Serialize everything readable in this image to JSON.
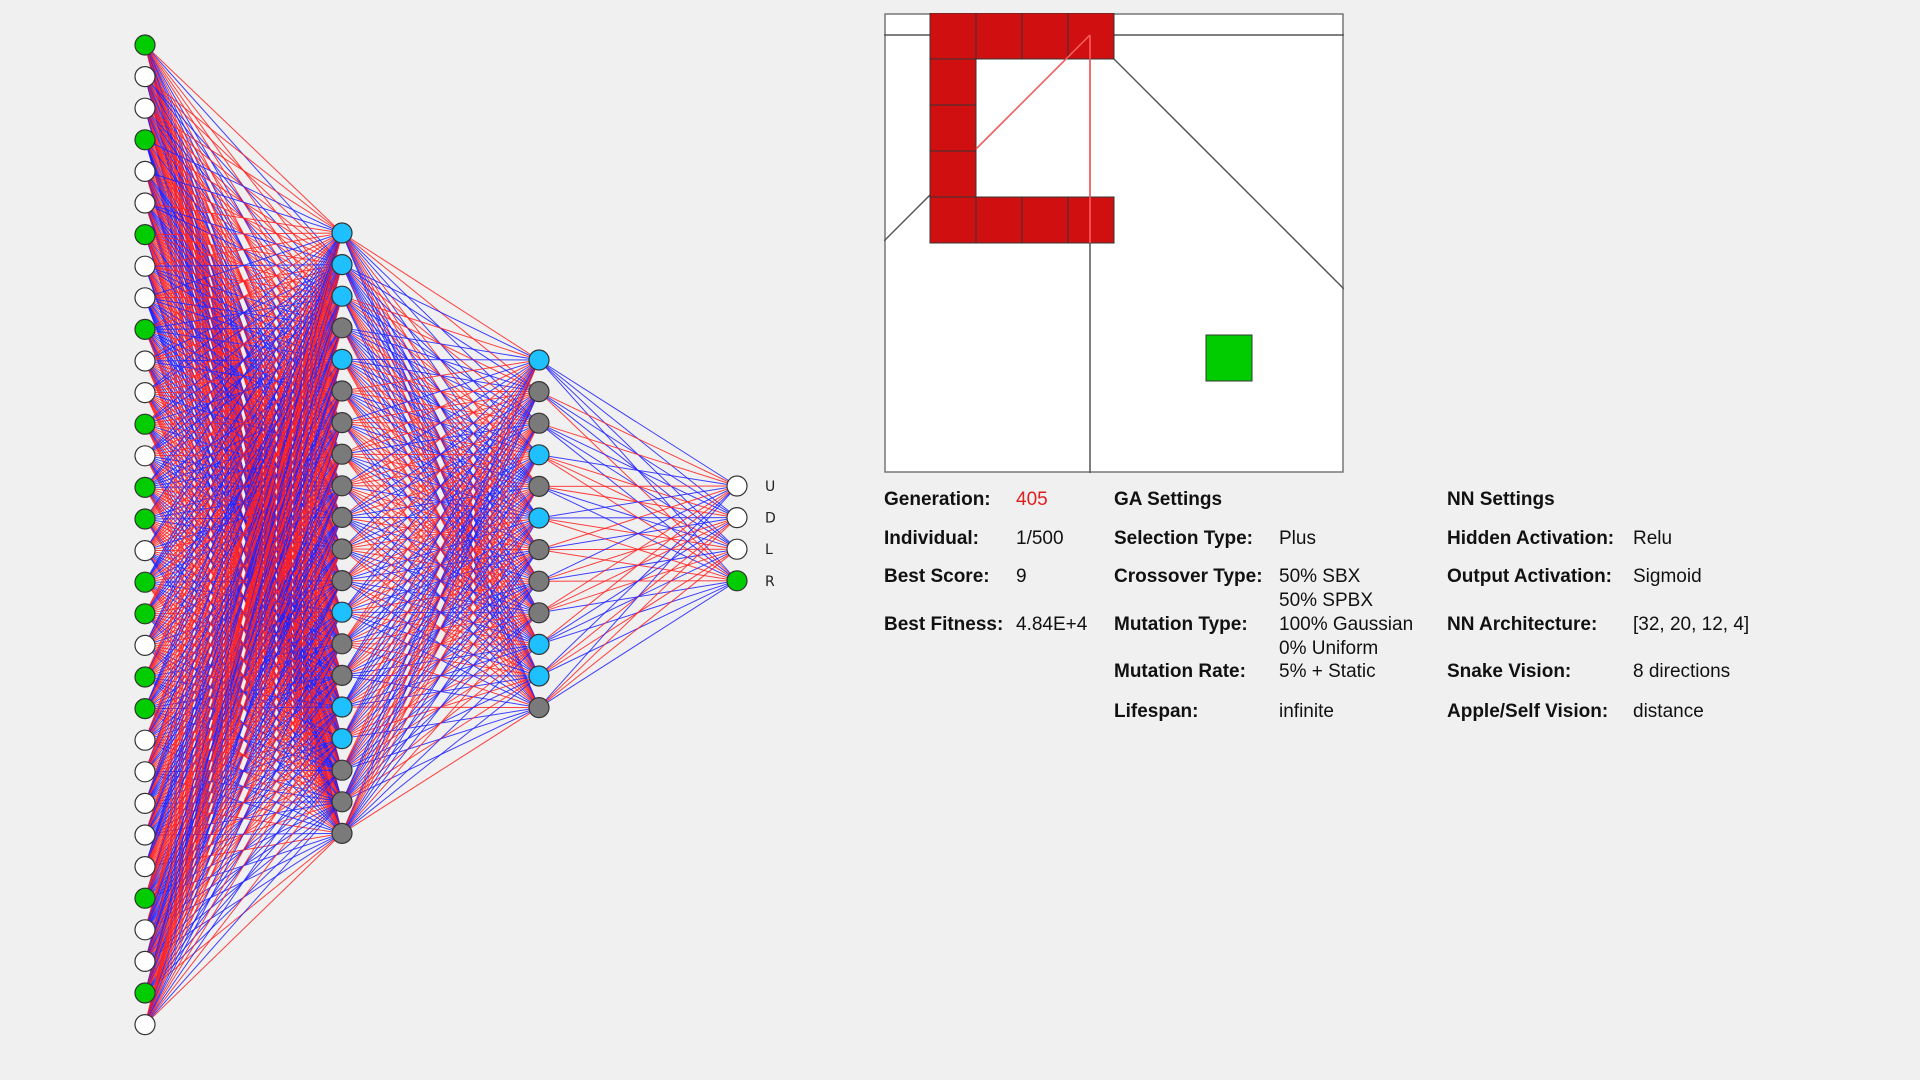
{
  "network": {
    "layers": [
      {
        "name": "input",
        "active": [
          1,
          0,
          0,
          1,
          0,
          0,
          1,
          0,
          0,
          1,
          0,
          0,
          1,
          0,
          1,
          1,
          0,
          1,
          1,
          0,
          1,
          1,
          0,
          0,
          0,
          0,
          0,
          1,
          0,
          0,
          1,
          0
        ]
      },
      {
        "name": "hidden1",
        "active": [
          1,
          1,
          1,
          0,
          1,
          0,
          0,
          0,
          0,
          0,
          0,
          0,
          1,
          0,
          0,
          1,
          1,
          0,
          0,
          0
        ]
      },
      {
        "name": "hidden2",
        "active": [
          1,
          0,
          0,
          1,
          0,
          1,
          0,
          0,
          0,
          1,
          1,
          0
        ]
      },
      {
        "name": "output",
        "active": [
          0,
          0,
          0,
          1
        ]
      }
    ],
    "output_labels": [
      "U",
      "D",
      "L",
      "R"
    ],
    "colors": {
      "input_active": "#00cc00",
      "hidden_active": "#1ec0ff",
      "hidden_inactive": "#7a7a7a",
      "inactive_fill": "#ffffff",
      "positive_weight": "#ff2020",
      "negative_weight": "#2020ff"
    }
  },
  "game": {
    "grid_cells": 10,
    "snake_cells": [
      [
        1,
        0
      ],
      [
        2,
        0
      ],
      [
        3,
        0
      ],
      [
        4,
        0
      ],
      [
        1,
        1
      ],
      [
        1,
        2
      ],
      [
        1,
        3
      ],
      [
        1,
        4
      ],
      [
        2,
        4
      ],
      [
        3,
        4
      ],
      [
        4,
        4
      ]
    ],
    "apple": [
      7,
      7
    ],
    "snake_color": "#d01010",
    "apple_color": "#00cc00"
  },
  "stats": {
    "generation_label": "Generation:",
    "generation_value": "405",
    "individual_label": "Individual:",
    "individual_value": "1/500",
    "best_score_label": "Best Score:",
    "best_score_value": "9",
    "best_fitness_label": "Best Fitness:",
    "best_fitness_value": "4.84E+4"
  },
  "ga_settings": {
    "heading": "GA Settings",
    "selection_label": "Selection Type:",
    "selection_value": "Plus",
    "crossover_label": "Crossover Type:",
    "crossover_value_1": "50% SBX",
    "crossover_value_2": "50% SPBX",
    "mutation_type_label": "Mutation Type:",
    "mutation_type_value_1": "100% Gaussian",
    "mutation_type_value_2": "0% Uniform",
    "mutation_rate_label": "Mutation Rate:",
    "mutation_rate_value": "5% + Static",
    "lifespan_label": "Lifespan:",
    "lifespan_value": "infinite"
  },
  "nn_settings": {
    "heading": "NN Settings",
    "hidden_activation_label": "Hidden Activation:",
    "hidden_activation_value": "Relu",
    "output_activation_label": "Output Activation:",
    "output_activation_value": "Sigmoid",
    "architecture_label": "NN Architecture:",
    "architecture_value": "[32, 20, 12, 4]",
    "snake_vision_label": "Snake Vision:",
    "snake_vision_value": "8 directions",
    "apple_self_label": "Apple/Self Vision:",
    "apple_self_value": "distance"
  }
}
